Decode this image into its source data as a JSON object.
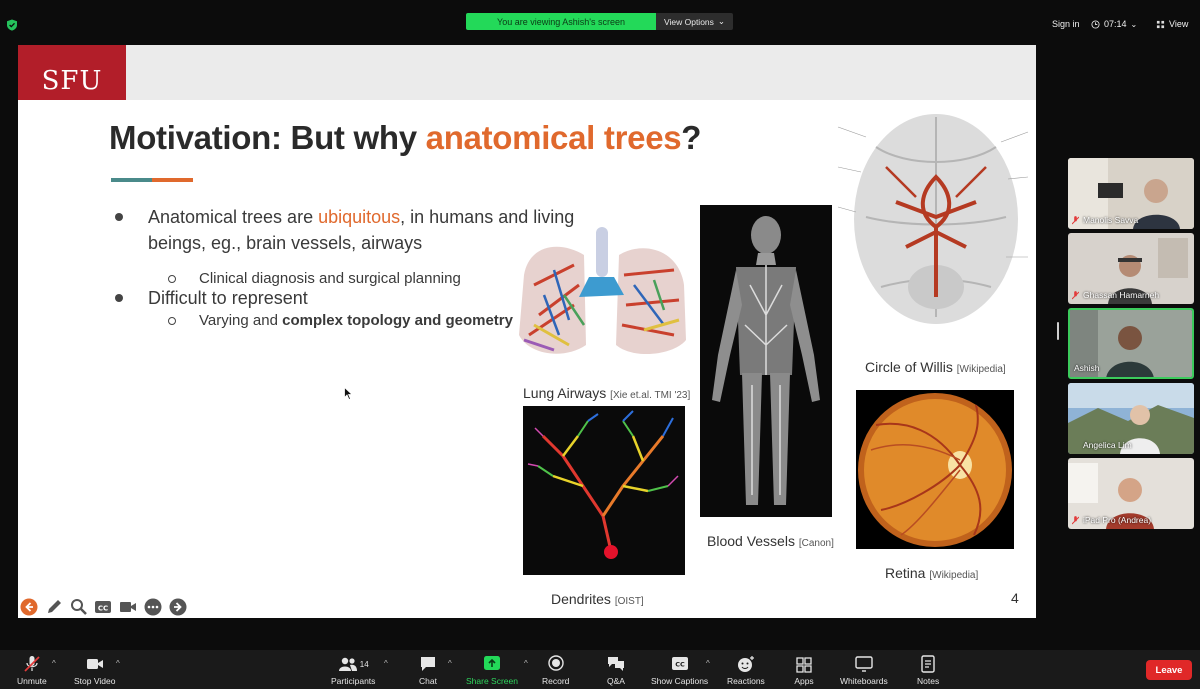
{
  "topbar": {
    "viewing_label": "You are viewing Ashish's screen",
    "view_options_label": "View Options",
    "sign_in_label": "Sign in",
    "timer": "07:14",
    "view_label": "View"
  },
  "slide": {
    "logo_text": "SFU",
    "title_prefix": "Motivation: But why ",
    "title_accent": "anatomical trees",
    "title_suffix": "?",
    "bullet1_prefix": "Anatomical trees are ",
    "bullet1_highlight": "ubiquitous",
    "bullet1_suffix": ", in humans and living beings, eg., brain vessels, airways",
    "sub1": "Clinical diagnosis and surgical planning",
    "bullet2": "Difficult to represent",
    "sub2_prefix": "Varying and ",
    "sub2_bold": "complex topology and geometry",
    "page_number": "4",
    "images": [
      {
        "caption": "Lung Airways",
        "source": "[Xie et.al. TMI '23]"
      },
      {
        "caption": "Blood Vessels",
        "source": "[Canon]"
      },
      {
        "caption": "Circle of Willis",
        "source": "[Wikipedia]"
      },
      {
        "caption": "Dendrites",
        "source": "[OIST]"
      },
      {
        "caption": "Retina",
        "source": "[Wikipedia]"
      }
    ]
  },
  "participants_panel": [
    {
      "name": "Manolis Savva",
      "muted": true
    },
    {
      "name": "Ghassan Hamarneh",
      "muted": true
    },
    {
      "name": "Ashish",
      "muted": false,
      "active_speaker": true
    },
    {
      "name": "Angelica Lim",
      "muted": false
    },
    {
      "name": "iPad Pro (Andrea)",
      "muted": true
    }
  ],
  "toolbar": {
    "unmute": "Unmute",
    "stop_video": "Stop Video",
    "participants": "Participants",
    "participants_count": "14",
    "chat": "Chat",
    "share_screen": "Share Screen",
    "record": "Record",
    "qa": "Q&A",
    "show_captions": "Show Captions",
    "reactions": "Reactions",
    "apps": "Apps",
    "whiteboards": "Whiteboards",
    "notes": "Notes",
    "leave": "Leave"
  },
  "colors": {
    "accent_orange": "#e0692d",
    "sfu_red": "#b21e29",
    "share_green": "#23d959",
    "leave_red": "#e02828",
    "active_border": "#3ccb5c"
  }
}
